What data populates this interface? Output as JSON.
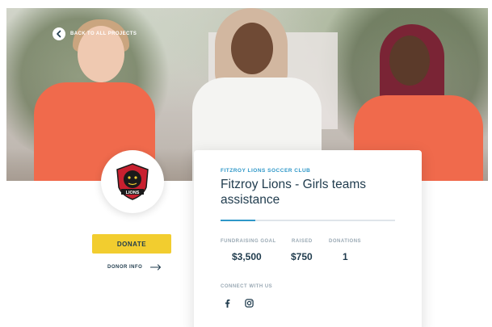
{
  "nav": {
    "back_label": "BACK TO ALL PROJECTS"
  },
  "icons": {
    "back": "arrow-left-icon",
    "donor_arrow": "arrow-right-icon",
    "facebook": "facebook-icon",
    "instagram": "instagram-icon",
    "logo": "club-logo-icon"
  },
  "logo": {
    "text": "LIONS"
  },
  "actions": {
    "donate_label": "DONATE",
    "donor_info_label": "DONOR INFO"
  },
  "project": {
    "club": "FITZROY LIONS SOCCER CLUB",
    "title": "Fitzroy Lions - Girls teams assistance",
    "progress": 0.2
  },
  "stats": [
    {
      "label": "FUNDRAISING GOAL",
      "value": "$3,500"
    },
    {
      "label": "RAISED",
      "value": "$750"
    },
    {
      "label": "DONATIONS",
      "value": "1"
    }
  ],
  "connect_label": "CONNECT WITH US",
  "colors": {
    "accent": "#2e97c8",
    "donate": "#f2cd2f",
    "heading": "#1f3b4d"
  }
}
